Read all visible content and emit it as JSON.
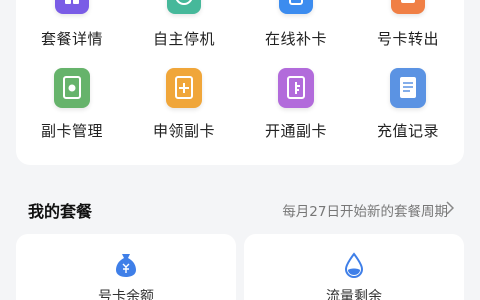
{
  "services": [
    {
      "label": "套餐详情",
      "icon": "package-detail-icon",
      "color": "#7a5ce6"
    },
    {
      "label": "自主停机",
      "icon": "self-suspend-icon",
      "color": "#46b89a"
    },
    {
      "label": "在线补卡",
      "icon": "card-reissue-icon",
      "color": "#3c8cef"
    },
    {
      "label": "号卡转出",
      "icon": "number-transfer-icon",
      "color": "#f07f45"
    },
    {
      "label": "副卡管理",
      "icon": "secondary-card-manage-icon",
      "color": "#66b36b"
    },
    {
      "label": "申领副卡",
      "icon": "apply-secondary-card-icon",
      "color": "#f0a63a"
    },
    {
      "label": "开通副卡",
      "icon": "activate-secondary-card-icon",
      "color": "#b26bdb"
    },
    {
      "label": "充值记录",
      "icon": "recharge-record-icon",
      "color": "#5b93e3"
    }
  ],
  "my_plan": {
    "title": "我的套餐",
    "cycle_note": "每月27日开始新的套餐周期"
  },
  "stats": [
    {
      "label": "号卡余额",
      "icon": "balance-icon",
      "color": "#3f7fe8"
    },
    {
      "label": "流量剩余",
      "icon": "data-remaining-icon",
      "color": "#3f7fe8"
    }
  ]
}
